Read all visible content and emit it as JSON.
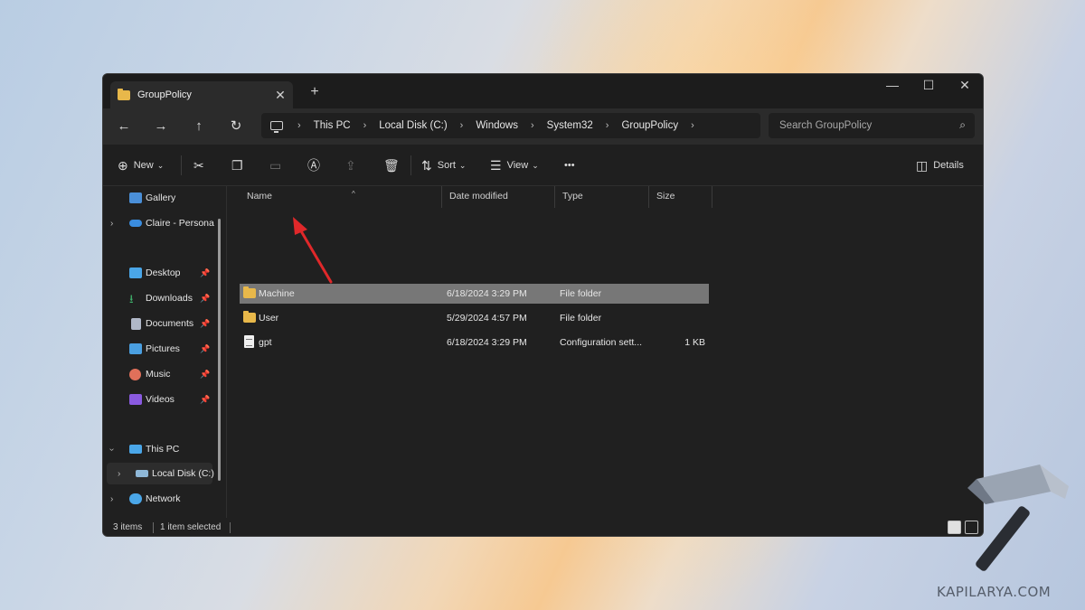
{
  "window": {
    "tab_title": "GroupPolicy",
    "close_tab": "✕",
    "new_tab": "+",
    "controls": {
      "minimize": "—",
      "maximize": "☐",
      "close": "✕"
    }
  },
  "nav": {
    "back": "←",
    "forward": "→",
    "up": "↑",
    "refresh": "↻"
  },
  "breadcrumb": {
    "items": [
      "This PC",
      "Local Disk (C:)",
      "Windows",
      "System32",
      "GroupPolicy"
    ],
    "separator": "›"
  },
  "search": {
    "placeholder": "Search GroupPolicy",
    "icon": "search-icon"
  },
  "toolbar": {
    "new_label": "New",
    "sort_label": "Sort",
    "view_label": "View",
    "more_label": "•••",
    "details_label": "Details"
  },
  "sidebar": {
    "items": [
      {
        "label": "Gallery",
        "icon": "gallery-icon",
        "color": "#4a8fd8"
      },
      {
        "label": "Claire - Persona",
        "icon": "cloud-icon",
        "color": "#3a8de0"
      },
      {
        "label": "Desktop",
        "icon": "desktop-icon",
        "color": "#4aa6e8"
      },
      {
        "label": "Downloads",
        "icon": "download-icon",
        "color": "#3fae6a"
      },
      {
        "label": "Documents",
        "icon": "document-icon",
        "color": "#b0b8c8"
      },
      {
        "label": "Pictures",
        "icon": "pictures-icon",
        "color": "#4a9fe0"
      },
      {
        "label": "Music",
        "icon": "music-icon",
        "color": "#e0705a"
      },
      {
        "label": "Videos",
        "icon": "videos-icon",
        "color": "#8a5ae0"
      },
      {
        "label": "This PC",
        "icon": "computer-icon",
        "color": "#4aa6e8"
      },
      {
        "label": "Local Disk (C:)",
        "icon": "drive-icon",
        "color": "#8fb8d8"
      },
      {
        "label": "Network",
        "icon": "network-icon",
        "color": "#4aa6e8"
      }
    ]
  },
  "columns": {
    "name": "Name",
    "date": "Date modified",
    "type": "Type",
    "size": "Size"
  },
  "files": [
    {
      "name": "Machine",
      "date": "6/18/2024 3:29 PM",
      "type": "File folder",
      "size": "",
      "icon": "folder-icon",
      "selected": true
    },
    {
      "name": "User",
      "date": "5/29/2024 4:57 PM",
      "type": "File folder",
      "size": "",
      "icon": "folder-icon",
      "selected": false
    },
    {
      "name": "gpt",
      "date": "6/18/2024 3:29 PM",
      "type": "Configuration sett...",
      "size": "1 KB",
      "icon": "config-file-icon",
      "selected": false
    }
  ],
  "status": {
    "count": "3 items",
    "selected": "1 item selected"
  },
  "watermark": "KAPILARYA.COM",
  "colors": {
    "accent_arrow": "#e0282a",
    "selection": "#777777",
    "folder": "#e8b84a"
  }
}
